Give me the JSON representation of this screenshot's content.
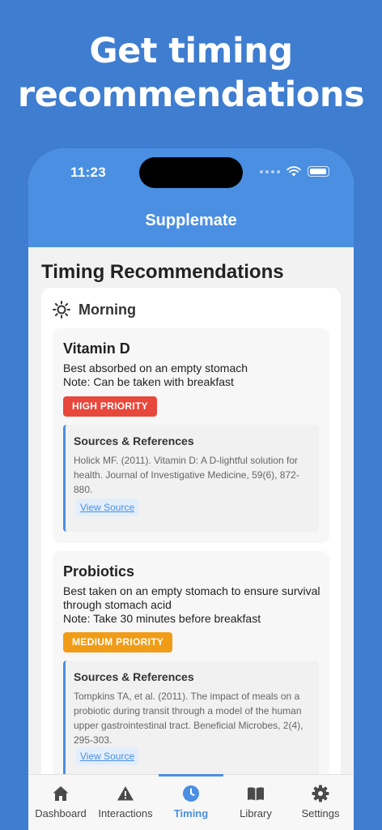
{
  "promo": {
    "line1": "Get timing",
    "line2": "recommendations"
  },
  "status_bar": {
    "time": "11:23"
  },
  "app": {
    "title": "Supplemate"
  },
  "page": {
    "title": "Timing Recommendations",
    "section": {
      "icon": "sun-icon",
      "title": "Morning",
      "cards": [
        {
          "name": "Vitamin D",
          "line1": "Best absorbed on an empty stomach",
          "line2": "Note: Can be taken with breakfast",
          "priority": "HIGH PRIORITY",
          "priority_color": "#e8473b",
          "sources_title": "Sources & References",
          "sources_text": "Holick MF. (2011). Vitamin D: A D-lightful solution for health. Journal of Investigative Medicine, 59(6), 872-880.",
          "link": "View Source"
        },
        {
          "name": "Probiotics",
          "line1": "Best taken on an empty stomach to ensure survival through stomach acid",
          "line2": "Note: Take 30 minutes before breakfast",
          "priority": "MEDIUM PRIORITY",
          "priority_color": "#f09c17",
          "sources_title": "Sources & References",
          "sources_text": "Tompkins TA, et al. (2011). The impact of meals on a probiotic during transit through a model of the human upper gastrointestinal tract. Beneficial Microbes, 2(4), 295-303.",
          "link": "View Source"
        }
      ]
    }
  },
  "tabs": [
    {
      "label": "Dashboard",
      "icon": "home-icon",
      "active": false
    },
    {
      "label": "Interactions",
      "icon": "warning-icon",
      "active": false
    },
    {
      "label": "Timing",
      "icon": "clock-icon",
      "active": true
    },
    {
      "label": "Library",
      "icon": "book-icon",
      "active": false
    },
    {
      "label": "Settings",
      "icon": "gear-icon",
      "active": false
    }
  ],
  "colors": {
    "brand": "#4a8fe2",
    "background": "#3f7dd0",
    "icon_gray": "#4a4a4a"
  }
}
